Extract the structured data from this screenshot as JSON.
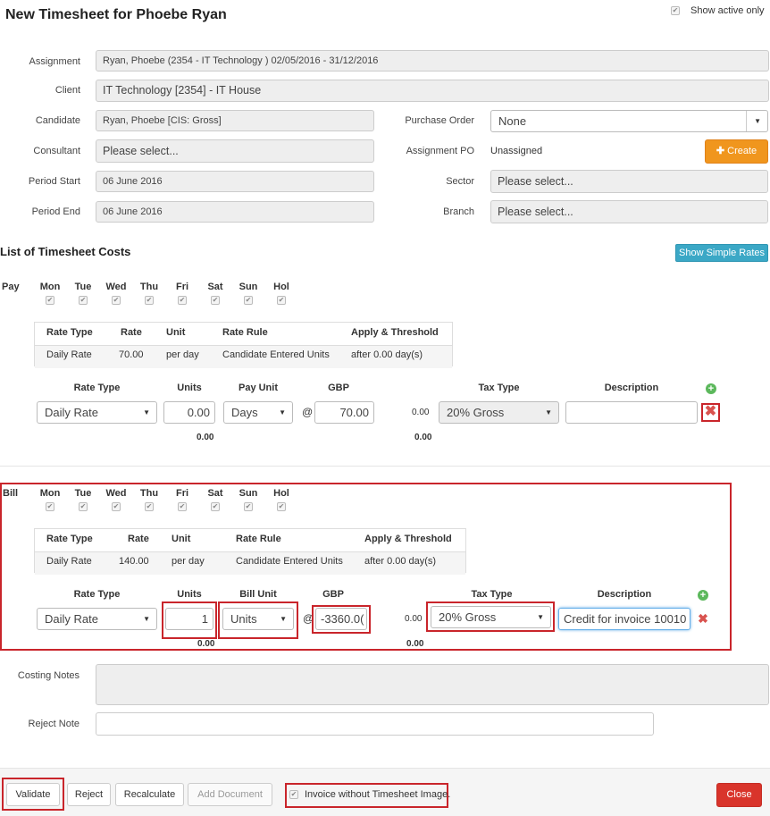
{
  "header": {
    "title": "New Timesheet for Phoebe Ryan",
    "show_active_only": "Show active only"
  },
  "form": {
    "assignment_label": "Assignment",
    "assignment_value": "Ryan, Phoebe (2354 - IT Technology ) 02/05/2016 - 31/12/2016",
    "client_label": "Client",
    "client_value": "IT Technology  [2354] - IT House",
    "candidate_label": "Candidate",
    "candidate_value": "Ryan, Phoebe [CIS: Gross]",
    "consultant_label": "Consultant",
    "consultant_value": "Please select...",
    "period_start_label": "Period Start",
    "period_start_value": "06 June 2016",
    "period_end_label": "Period End",
    "period_end_value": "06 June 2016",
    "purchase_order_label": "Purchase Order",
    "purchase_order_value": "None",
    "assignment_po_label": "Assignment PO",
    "assignment_po_value": "Unassigned",
    "create_label": "Create",
    "sector_label": "Sector",
    "sector_value": "Please select...",
    "branch_label": "Branch",
    "branch_value": "Please select..."
  },
  "costs": {
    "title": "List of Timesheet Costs",
    "show_simple_rates": "Show Simple Rates"
  },
  "days": [
    "Mon",
    "Tue",
    "Wed",
    "Thu",
    "Fri",
    "Sat",
    "Sun",
    "Hol"
  ],
  "pay": {
    "label": "Pay",
    "rate_headers": [
      "Rate Type",
      "Rate",
      "Unit",
      "Rate Rule",
      "Apply & Threshold"
    ],
    "rate_row": [
      "Daily Rate",
      "70.00",
      "per day",
      "Candidate Entered Units",
      "after 0.00 day(s)"
    ],
    "line_headers": {
      "rate_type": "Rate Type",
      "units": "Units",
      "unit": "Pay Unit",
      "currency": "GBP",
      "tax_type": "Tax Type",
      "description": "Description"
    },
    "line": {
      "rate_type": "Daily Rate",
      "units": "0.00",
      "unit": "Days",
      "at": "@",
      "amount": "70.00",
      "tax_amount": "0.00",
      "tax_type": "20% Gross",
      "description": ""
    },
    "totals": {
      "units": "0.00",
      "tax": "0.00"
    }
  },
  "bill": {
    "label": "Bill",
    "rate_headers": [
      "Rate Type",
      "Rate",
      "Unit",
      "Rate Rule",
      "Apply & Threshold"
    ],
    "rate_row": [
      "Daily Rate",
      "140.00",
      "per day",
      "Candidate Entered Units",
      "after 0.00 day(s)"
    ],
    "line_headers": {
      "rate_type": "Rate Type",
      "units": "Units",
      "unit": "Bill Unit",
      "currency": "GBP",
      "tax_type": "Tax Type",
      "description": "Description"
    },
    "line": {
      "rate_type": "Daily Rate",
      "units": "1",
      "unit": "Units",
      "at": "@",
      "amount": "-3360.0(",
      "tax_amount": "0.00",
      "tax_type": "20% Gross",
      "description": "Credit for invoice 10010"
    },
    "totals": {
      "units": "0.00",
      "tax": "0.00"
    }
  },
  "notes": {
    "costing_label": "Costing Notes",
    "reject_label": "Reject Note"
  },
  "footer": {
    "validate": "Validate",
    "reject": "Reject",
    "recalculate": "Recalculate",
    "add_document": "Add Document",
    "invoice_without": "Invoice without Timesheet Image.",
    "close": "Close"
  }
}
